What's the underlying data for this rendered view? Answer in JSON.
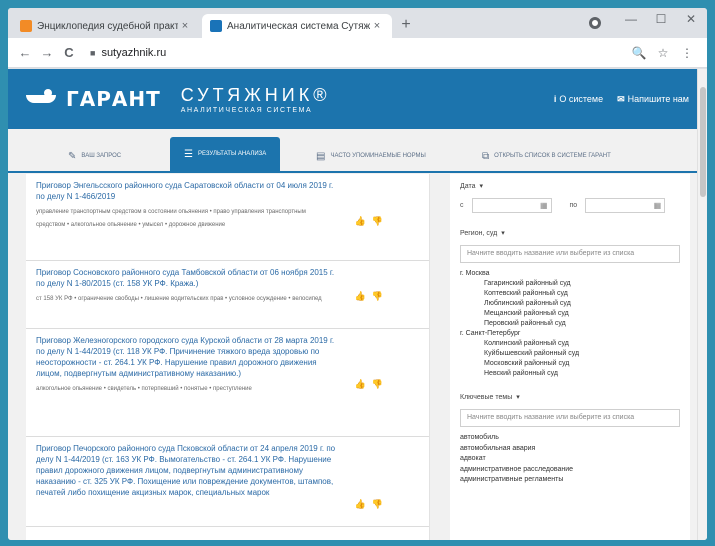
{
  "browser": {
    "tabs": [
      {
        "title": "Энциклопедия судебной практ...",
        "close": "×"
      },
      {
        "title": "Аналитическая система Сутяж...",
        "close": "×"
      }
    ],
    "new_tab": "+",
    "window_controls": {
      "minimize": "—",
      "maximize": "☐",
      "close": "✕"
    },
    "nav": {
      "back": "←",
      "forward": "→",
      "reload": "C"
    },
    "url": "sutyazhnik.ru",
    "toolbar_icons": {
      "zoom": "🔍",
      "star": "☆",
      "menu": "⋮"
    }
  },
  "site": {
    "brand_garant": "ГАРАНТ",
    "brand_name": "СУТЯЖНИК®",
    "brand_sub": "АНАЛИТИЧЕСКАЯ СИСТЕМА",
    "links": [
      {
        "icon": "i",
        "label": "О системе"
      },
      {
        "icon": "✉",
        "label": "Напишите нам"
      }
    ]
  },
  "page_tabs": [
    {
      "icon": "✎",
      "label": "ВАШ ЗАПРОС"
    },
    {
      "icon": "☰",
      "label": "РЕЗУЛЬТАТЫ АНАЛИЗА"
    },
    {
      "icon": "▤",
      "label": "ЧАСТО УПОМИНАЕМЫЕ НОРМЫ"
    },
    {
      "icon": "⧉",
      "label": "ОТКРЫТЬ СПИСОК В СИСТЕМЕ ГАРАНТ"
    }
  ],
  "results": [
    {
      "title": "Приговор Энгельсского районного суда Саратовской области от 04 июля 2019 г. по делу N 1-466/2019",
      "tags": "управление транспортным средством в состоянии опьянения • право управления транспортным средством • алкогольное опьянение • умысел • дорожное движение"
    },
    {
      "title": "Приговор Сосновского районного суда Тамбовской области от 06 ноября 2015 г. по делу N 1-80/2015 (ст. 158 УК РФ. Кража.)",
      "tags": "ст 158 УК РФ • ограничение свободы • лишение водительских прав • условное осуждение • велосипед"
    },
    {
      "title": "Приговор Железногорского городского суда Курской области от 28 марта 2019 г. по делу N 1-44/2019 (ст. 118 УК РФ. Причинение тяжкого вреда здоровью по неосторожности - ст. 264.1 УК РФ. Нарушение правил дорожного движения лицом, подвергнутым административному наказанию.)",
      "tags": "алкогольное опьянение • свидетель • потерпевший • понятые • преступление"
    },
    {
      "title": "Приговор Печорского районного суда Псковской области от 24 апреля 2019 г. по делу N 1-44/2019 (ст. 163 УК РФ. Вымогательство - ст. 264.1 УК РФ. Нарушение правил дорожного движения лицом, подвергнутым административному наказанию - ст. 325 УК РФ. Похищение или повреждение документов, штампов, печатей либо похищение акцизных марок, специальных марок",
      "tags": ""
    }
  ],
  "filters": {
    "date_label": "Дата",
    "date_from": "с",
    "date_to": "по",
    "region_label": "Регион, суд",
    "region_placeholder": "Начните вводить название или выберите из списка",
    "regions": [
      {
        "name": "г. Москва",
        "courts": [
          "Гагаринский районный суд",
          "Коптевский районный суд",
          "Люблинский районный суд",
          "Мещанский районный суд",
          "Перовский районный суд"
        ]
      },
      {
        "name": "г. Санкт-Петербург",
        "courts": [
          "Колпинский районный суд",
          "Куйбышевский районный суд",
          "Московский районный суд",
          "Невский районный суд"
        ]
      }
    ],
    "themes_label": "Ключевые темы",
    "themes_placeholder": "Начните вводить название или выберите из списка",
    "themes": [
      "автомобиль",
      "автомобильная авария",
      "адвокат",
      "административное расследование",
      "административные регламенты"
    ]
  },
  "colors": {
    "brand_blue": "#1c74ad",
    "link_blue": "#2b6aa6",
    "background": "#2f8fb0"
  }
}
